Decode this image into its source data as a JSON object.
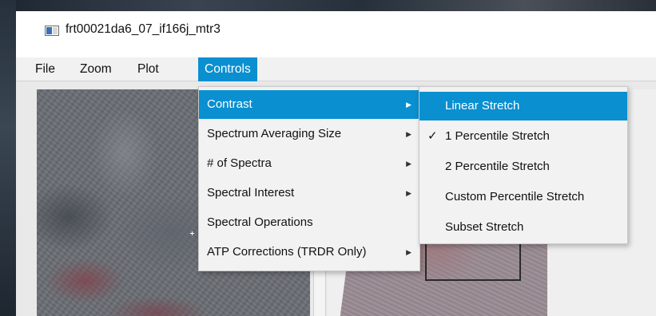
{
  "window": {
    "title": "frt00021da6_07_if166j_mtr3"
  },
  "menubar": {
    "items": [
      {
        "label": "File"
      },
      {
        "label": "Zoom"
      },
      {
        "label": "Plot"
      },
      {
        "label": "Controls"
      }
    ],
    "active": "Controls"
  },
  "controls_menu": {
    "items": [
      {
        "label": "Contrast",
        "submenu": true
      },
      {
        "label": "Spectrum Averaging Size",
        "submenu": true
      },
      {
        "label": "# of Spectra",
        "submenu": true
      },
      {
        "label": "Spectral Interest",
        "submenu": true
      },
      {
        "label": "Spectral Operations",
        "submenu": false
      },
      {
        "label": "ATP Corrections (TRDR Only)",
        "submenu": true
      }
    ],
    "highlighted": "Contrast"
  },
  "contrast_submenu": {
    "items": [
      {
        "label": "Linear Stretch",
        "checked": false
      },
      {
        "label": "1 Percentile Stretch",
        "checked": true
      },
      {
        "label": "2 Percentile Stretch",
        "checked": false
      },
      {
        "label": "Custom Percentile Stretch",
        "checked": false
      },
      {
        "label": "Subset Stretch",
        "checked": false
      }
    ],
    "highlighted": "Linear Stretch"
  },
  "icons": {
    "app": "app-window-icon",
    "submenu_arrow": "chevron-right-icon",
    "check": "checkmark-icon",
    "cursor": "crosshair-icon"
  },
  "colors": {
    "accent": "#0a8fd0",
    "menu_bg": "#f2f2f2"
  },
  "glyphs": {
    "arrow": "▶",
    "check": "✓"
  }
}
